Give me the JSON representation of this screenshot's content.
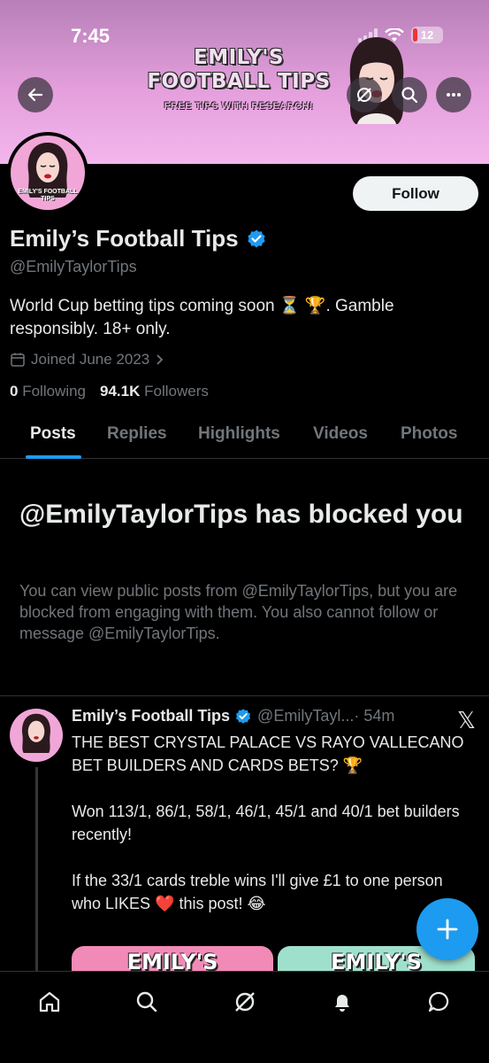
{
  "status_bar": {
    "time": "7:45",
    "battery": "12"
  },
  "banner": {
    "title": "EMILY'S FOOTBALL TIPS",
    "subtitle": "FREE TIPS WITH RESEARCH!"
  },
  "header_actions": {
    "back_icon": "arrow-left-icon",
    "grok_icon": "grok-icon",
    "search_icon": "search-icon",
    "more_icon": "more-icon"
  },
  "profile": {
    "avatar_text": "EMILY'S FOOTBALL TIPS",
    "follow_label": "Follow",
    "display_name": "Emily’s Football Tips",
    "handle": "@EmilyTaylorTips",
    "bio": "World Cup betting tips coming soon ⏳ 🏆. Gamble responsibly. 18+ only.",
    "joined": "Joined June 2023",
    "following_count": "0",
    "following_label": "Following",
    "followers_count": "94.1K",
    "followers_label": "Followers"
  },
  "tabs": [
    "Posts",
    "Replies",
    "Highlights",
    "Videos",
    "Photos"
  ],
  "blocked": {
    "title": "@EmilyTaylorTips has blocked you",
    "message": "You can view public posts from @EmilyTaylorTips, but you are blocked from engaging with them. You also cannot follow or message @EmilyTaylorTips."
  },
  "post": {
    "name": "Emily’s Football Tips",
    "handle": "@EmilyTayl...",
    "time": "· 54m",
    "line1": "THE BEST CRYSTAL PALACE VS RAYO VALLECANO BET BUILDERS AND CARDS BETS? 🏆",
    "line2": "Won 113/1, 86/1, 58/1, 46/1, 45/1 and 40/1 bet builders recently!",
    "line3": "If the 33/1 cards treble wins I'll give £1 to one person who LIKES ❤️ this post! 😂",
    "media1_text": "EMILY'S",
    "media2_text": "EMILY'S"
  },
  "colors": {
    "accent": "#1d9bf0",
    "banner": "#e49fdc",
    "muted": "#71767b"
  },
  "bottom_nav": [
    "home-icon",
    "search-icon",
    "grok-icon",
    "notifications-icon",
    "messages-icon"
  ]
}
